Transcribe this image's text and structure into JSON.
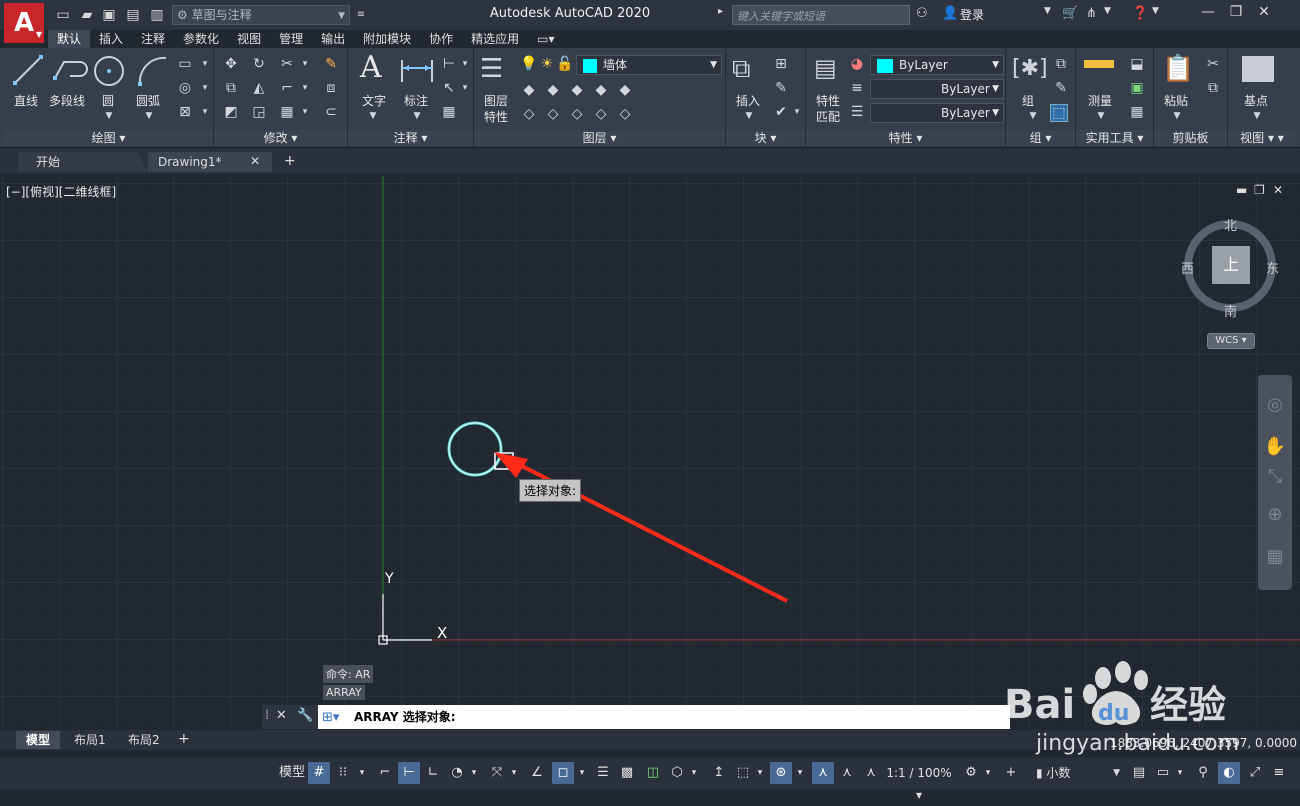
{
  "app": {
    "logo_letter": "A",
    "title": "Autodesk AutoCAD 2020",
    "workspace": "草图与注释",
    "search_placeholder": "键入关键字或短语",
    "login": "登录"
  },
  "menu_tabs": [
    "默认",
    "插入",
    "注释",
    "参数化",
    "视图",
    "管理",
    "输出",
    "附加模块",
    "协作",
    "精选应用"
  ],
  "active_menu_tab": "默认",
  "ribbon": {
    "draw": {
      "title": "绘图",
      "line": "直线",
      "polyline": "多段线",
      "circle": "圆",
      "arc": "圆弧"
    },
    "modify": {
      "title": "修改"
    },
    "annotation": {
      "title": "注释",
      "text": "文字",
      "dimension": "标注"
    },
    "layers": {
      "title": "图层",
      "props_line1": "图层",
      "props_line2": "特性",
      "current_layer": "墙体"
    },
    "block": {
      "title": "块",
      "insert": "插入"
    },
    "properties": {
      "title": "特性",
      "match_line1": "特性",
      "match_line2": "匹配",
      "color": "ByLayer",
      "linetype": "ByLayer",
      "lineweight": "ByLayer"
    },
    "groups": {
      "title": "组",
      "group": "组"
    },
    "utilities": {
      "title": "实用工具",
      "measure": "测量"
    },
    "clipboard": {
      "title": "剪贴板",
      "paste": "粘贴"
    },
    "view": {
      "title": "视图",
      "base": "基点"
    }
  },
  "doc_tabs": {
    "start": "开始",
    "drawing": "Drawing1*"
  },
  "viewport": {
    "label": "[−][俯视][二维线框]",
    "compass": {
      "north": "北",
      "south": "南",
      "east": "东",
      "west": "西",
      "top": "上"
    },
    "wcs": "WCS",
    "tooltip": "选择对象:",
    "ucs_x": "X",
    "ucs_y": "Y"
  },
  "command": {
    "history": [
      "命令: AR",
      "ARRAY"
    ],
    "prompt": "ARRAY 选择对象:"
  },
  "layout_tabs": [
    "模型",
    "布局1",
    "布局2"
  ],
  "active_layout": "模型",
  "coordinates": "1883.0696, 2407.3597, 0.0000",
  "status": {
    "model": "模型",
    "scale": "1:1 / 100%",
    "units": "小数"
  },
  "watermark": {
    "brand": "Bai",
    "brand2": "du",
    "cn": "经验",
    "url": "jingyan.baidu.com"
  },
  "colors": {
    "accent_cyan": "#00ffff",
    "logo_red": "#c8262a",
    "annotation_arrow": "#ff2a1a",
    "axis_green": "#2e7d32",
    "axis_red": "#8e2a2a"
  }
}
